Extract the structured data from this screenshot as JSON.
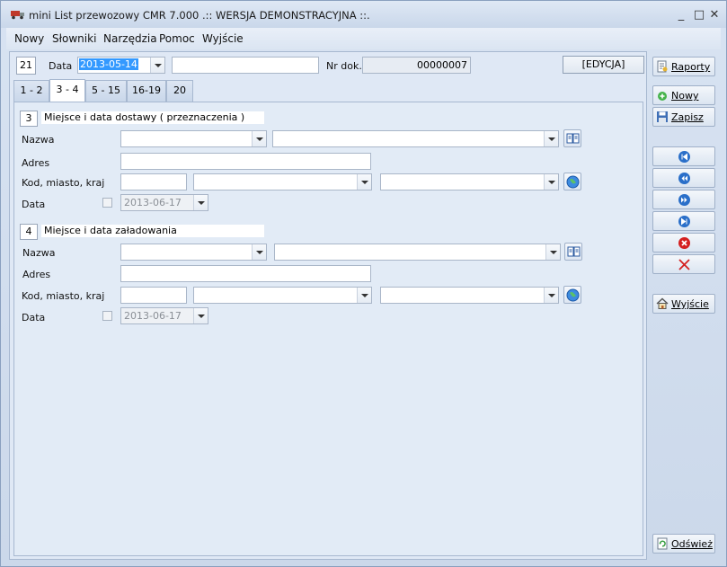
{
  "window": {
    "title": "mini List przewozowy CMR 7.000 .:: WERSJA DEMONSTRACYJNA ::.",
    "minimize_glyph": "_",
    "maximize_glyph": "□",
    "close_glyph": "✕"
  },
  "menu": [
    "Nowy",
    "Słowniki",
    "Narzędzia",
    "Pomoc",
    "Wyjście"
  ],
  "header": {
    "box_number": "21",
    "date_label": "Data",
    "date_value": "2013-05-14",
    "doc_label": "Nr dok.",
    "doc_number": "00000007",
    "mode": "[EDYCJA]"
  },
  "tabs": [
    {
      "label": "1 - 2",
      "active": false
    },
    {
      "label": "3 - 4",
      "active": true
    },
    {
      "label": "5 - 15",
      "active": false
    },
    {
      "label": "16-19",
      "active": false
    },
    {
      "label": "20",
      "active": false
    }
  ],
  "section3": {
    "number": "3",
    "title": "Miejsce i data dostawy ( przeznaczenia )",
    "name_label": "Nazwa",
    "address_label": "Adres",
    "postal_label": "Kod, miasto, kraj",
    "date_label": "Data",
    "date_value": "2013-06-17"
  },
  "section4": {
    "number": "4",
    "title": "Miejsce i data załadowania",
    "name_label": "Nazwa",
    "address_label": "Adres",
    "postal_label": "Kod, miasto, kraj",
    "date_label": "Data",
    "date_value": "2013-06-17"
  },
  "sidebar": {
    "reports": "Raporty",
    "new": "Nowy",
    "save": "Zapisz",
    "exit": "Wyjście",
    "refresh": "Odśwież"
  },
  "icons": {
    "book": "book-icon",
    "globe": "globe-icon",
    "first": "first-record-icon",
    "prev": "previous-record-icon",
    "next": "next-record-icon",
    "last": "last-record-icon",
    "delete": "delete-icon",
    "cancel": "cancel-icon"
  },
  "colors": {
    "selection": "#3399ff",
    "delete_red": "#d42020",
    "nav_blue": "#2a6fc9"
  }
}
